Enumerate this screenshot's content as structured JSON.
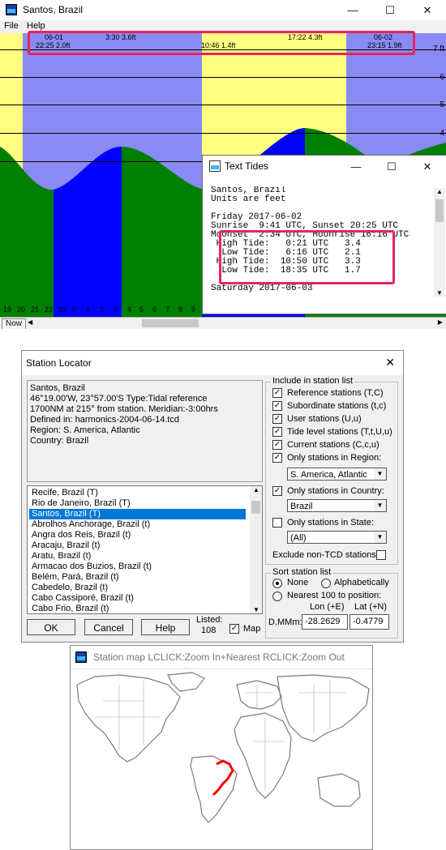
{
  "tide_window": {
    "title": "Santos, Brazil",
    "menu": [
      "File",
      "Help"
    ],
    "window_controls": [
      "—",
      "☐",
      "✕"
    ],
    "header_top": [
      {
        "text": "06-01"
      },
      {
        "text": "3:30 3.6ft"
      },
      {
        "text": "17:22 4.3ft"
      },
      {
        "text": "06-02"
      }
    ],
    "header_bottom": [
      {
        "text": "22:25 2.0ft"
      },
      {
        "text": "10:46 1.4ft"
      },
      {
        "text": "23:15 1.9ft"
      }
    ],
    "y_labels": [
      "7 ft",
      "6",
      "5",
      "4"
    ],
    "hour_ticks": [
      "19",
      "20",
      "21",
      "22",
      "23",
      "0",
      "1",
      "2",
      "3",
      "4",
      "5",
      "6",
      "7",
      "8",
      "9"
    ],
    "now_button": "Now",
    "colors": {
      "day": "#ffff80",
      "night": "#8a8af5",
      "rising": "#0000ff",
      "falling": "#008000",
      "highlight": "#e8245c"
    }
  },
  "text_tides": {
    "title": "Text Tides",
    "lines": [
      "Santos, Brazil",
      "Units are feet",
      "",
      "Friday 2017-06-02",
      "Sunrise  9:41 UTC, Sunset 20:25 UTC",
      "Moonset  2:34 UTC, Moonrise 16:16 UTC",
      " High Tide:   0:21 UTC   3.4",
      "  Low Tide:   6:16 UTC   2.1",
      " High Tide:  10:50 UTC   3.3",
      "  Low Tide:  18:35 UTC   1.7",
      "",
      "Saturday 2017-06-03"
    ]
  },
  "station_locator": {
    "title": "Station Locator",
    "info": [
      "Santos, Brazil",
      "46°19.00'W, 23°57.00'S  Type:Tidal reference",
      "1700NM at 215° from station. Meridian:-3:00hrs",
      "Defined in: harmonics-2004-06-14.tcd",
      "Region: S. America, Atlantic",
      "Country: Brazil"
    ],
    "stations": [
      "Recife, Brazil (T)",
      "Rio de Janeiro, Brazil (T)",
      "Santos, Brazil (T)",
      "Abrolhos Anchorage, Brazil (t)",
      "Angra dos Reis, Brazil (t)",
      "Aracaju, Brazil (t)",
      "Aratu, Brazil (t)",
      "Armacao dos Buzios, Brazil (t)",
      "Belém, Pará, Brazil (t)",
      "Cabedelo, Brazil (t)",
      "Cabo Cassiporé, Brazil (t)",
      "Cabo Frio, Brazil (t)"
    ],
    "selected_index": 2,
    "include_label": "Include in station list",
    "options": [
      {
        "label": "Reference stations (T,C)",
        "checked": true
      },
      {
        "label": "Subordinate stations (t,c)",
        "checked": true
      },
      {
        "label": "User stations (U,u)",
        "checked": true
      },
      {
        "label": "Tide level stations (T,t,U,u)",
        "checked": true
      },
      {
        "label": "Current stations (C,c,u)",
        "checked": true
      },
      {
        "label": "Only stations in Region:",
        "checked": true
      }
    ],
    "region_value": "S. America, Atlantic",
    "country_label": "Only stations in Country:",
    "country_value": "Brazil",
    "state_label": "Only stations in State:",
    "state_value": "(All)",
    "exclude_label": "Exclude non-TCD stations",
    "sort_label": "Sort station list",
    "sort_none": "None",
    "sort_alpha": "Alphabetically",
    "sort_nearest": "Nearest 100 to position:",
    "lon_label": "Lon (+E)",
    "lat_label": "Lat (+N)",
    "dmm_label": "D.MMm:",
    "lon_value": "-28.2629",
    "lat_value": "-0.4779",
    "ok": "OK",
    "cancel": "Cancel",
    "help": "Help",
    "listed_label": "Listed:",
    "listed_count": "108",
    "map_label": "Map",
    "close": "✕"
  },
  "station_map": {
    "title": "Station map LCLICK:Zoom In+Nearest  RCLICK:Zoom Out"
  }
}
